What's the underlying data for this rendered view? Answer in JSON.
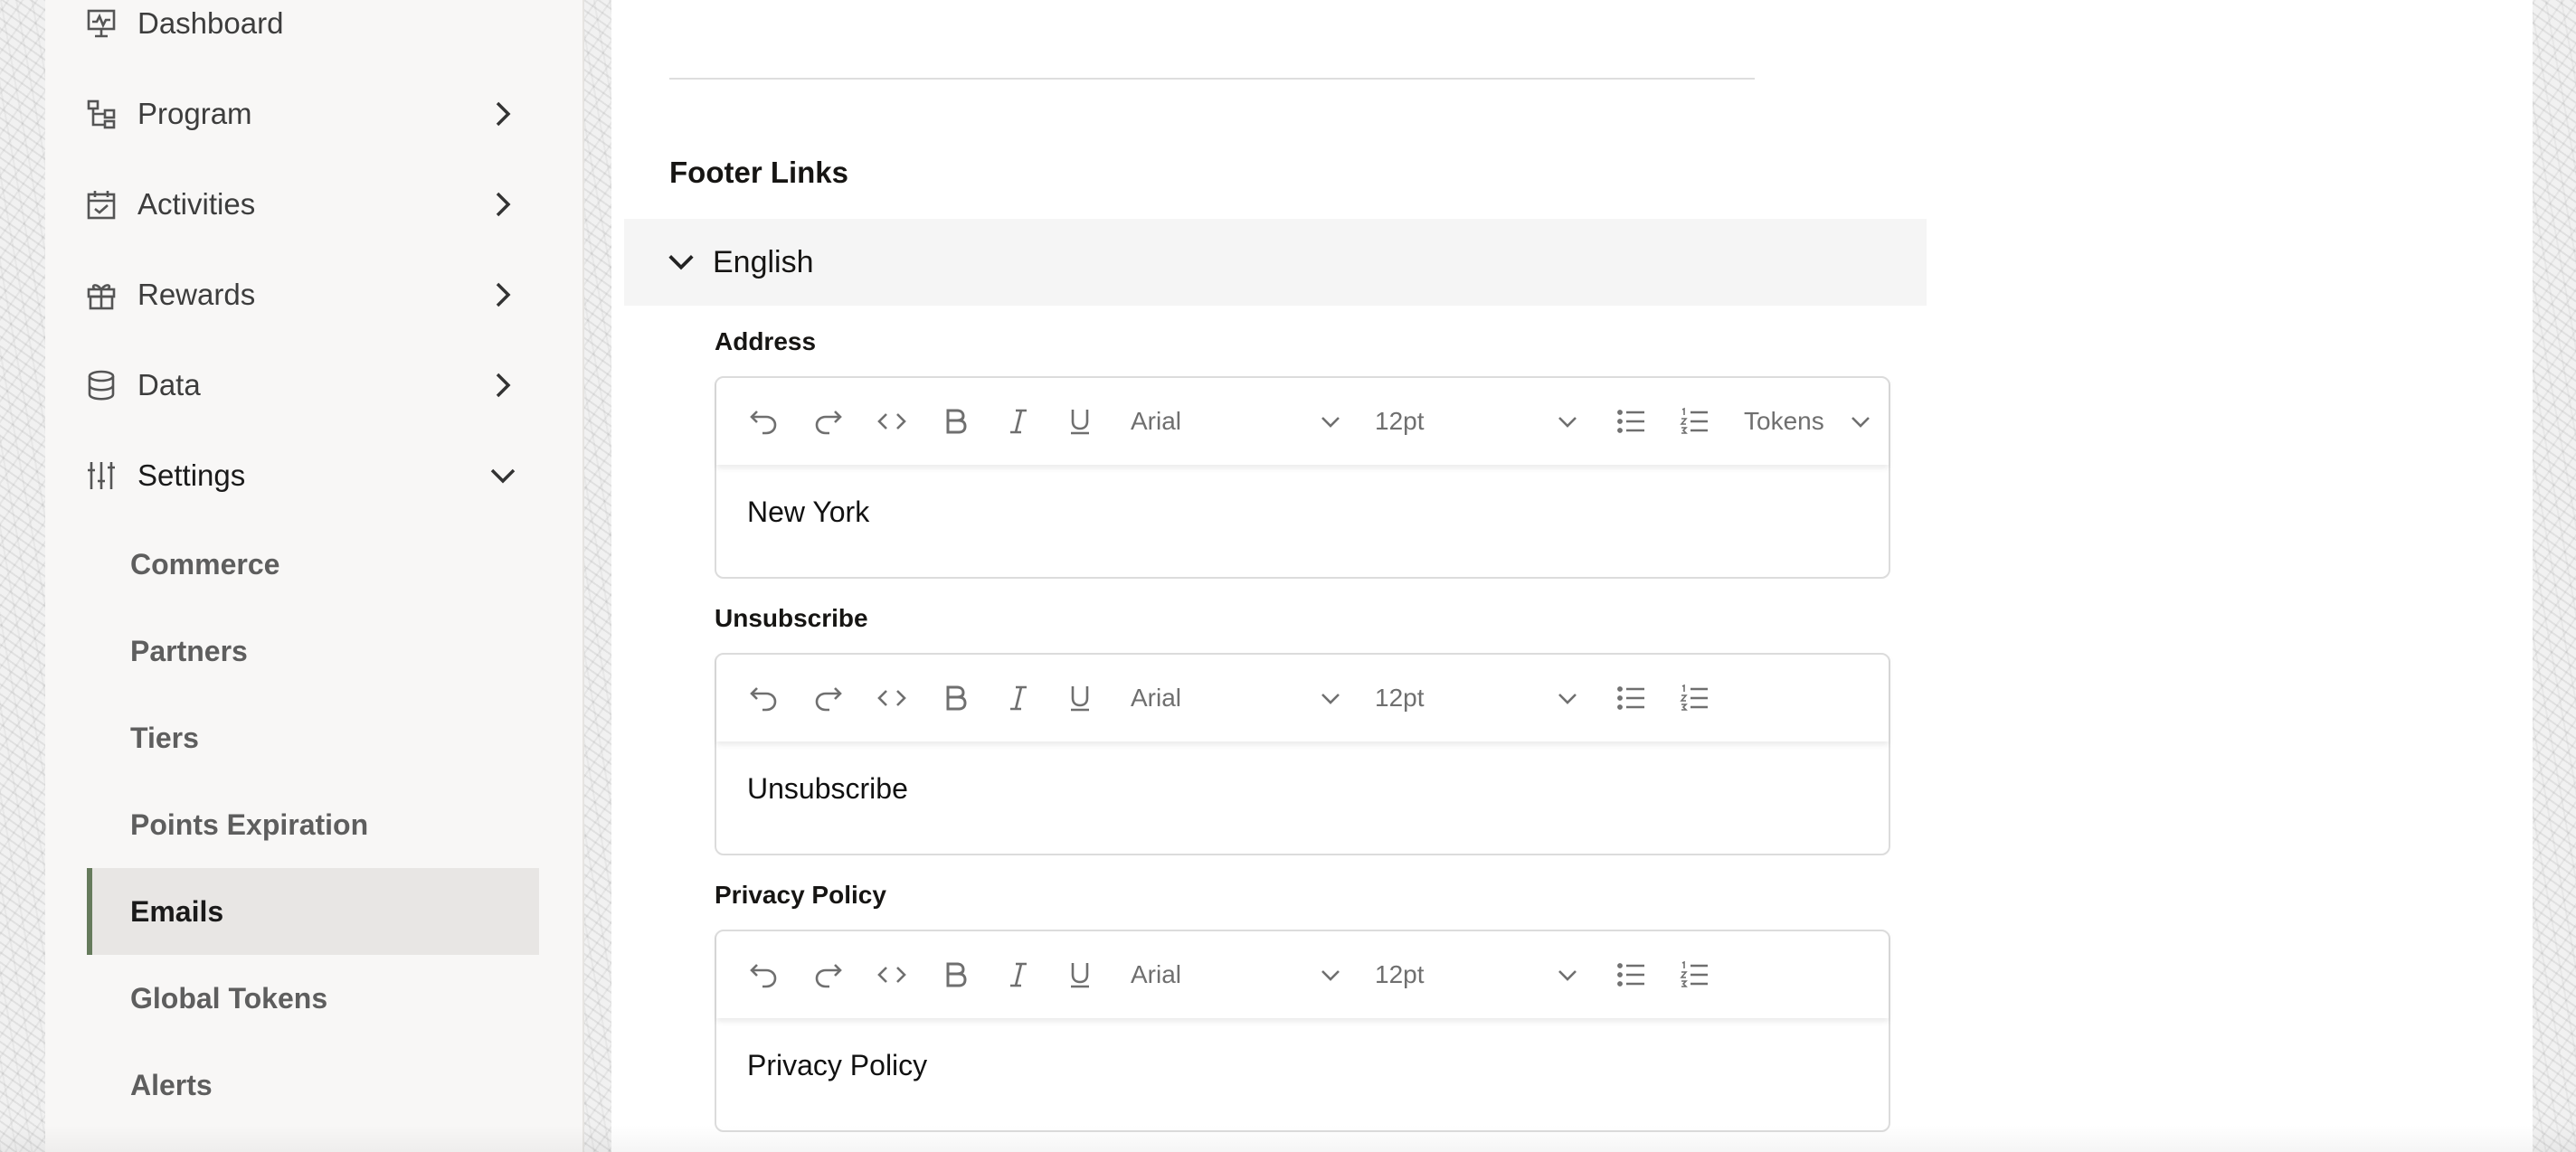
{
  "sidebar": {
    "items": [
      {
        "label": "Dashboard",
        "icon": "dashboard-icon",
        "expandable": false
      },
      {
        "label": "Program",
        "icon": "program-icon",
        "expandable": true
      },
      {
        "label": "Activities",
        "icon": "activities-icon",
        "expandable": true
      },
      {
        "label": "Rewards",
        "icon": "rewards-icon",
        "expandable": true
      },
      {
        "label": "Data",
        "icon": "data-icon",
        "expandable": true
      },
      {
        "label": "Settings",
        "icon": "settings-icon",
        "expandable": true,
        "expanded": true
      }
    ],
    "settings_children": [
      {
        "label": "Commerce"
      },
      {
        "label": "Partners"
      },
      {
        "label": "Tiers"
      },
      {
        "label": "Points Expiration"
      },
      {
        "label": "Emails",
        "active": true
      },
      {
        "label": "Global Tokens"
      },
      {
        "label": "Alerts"
      }
    ]
  },
  "main": {
    "section_title": "Footer Links",
    "accordion_label": "English",
    "fields": [
      {
        "label": "Address",
        "content": "New York",
        "font": "Arial",
        "size": "12pt",
        "tokens": "Tokens"
      },
      {
        "label": "Unsubscribe",
        "content": "Unsubscribe",
        "font": "Arial",
        "size": "12pt"
      },
      {
        "label": "Privacy Policy",
        "content": "Privacy Policy",
        "font": "Arial",
        "size": "12pt"
      }
    ]
  },
  "colors": {
    "active_indicator": "#667b5c",
    "sidebar_bg": "#f8f7f6",
    "active_bg": "#e8e6e4",
    "accordion_bg": "#f5f5f5",
    "toolbar_icon": "#6f6f6f"
  }
}
